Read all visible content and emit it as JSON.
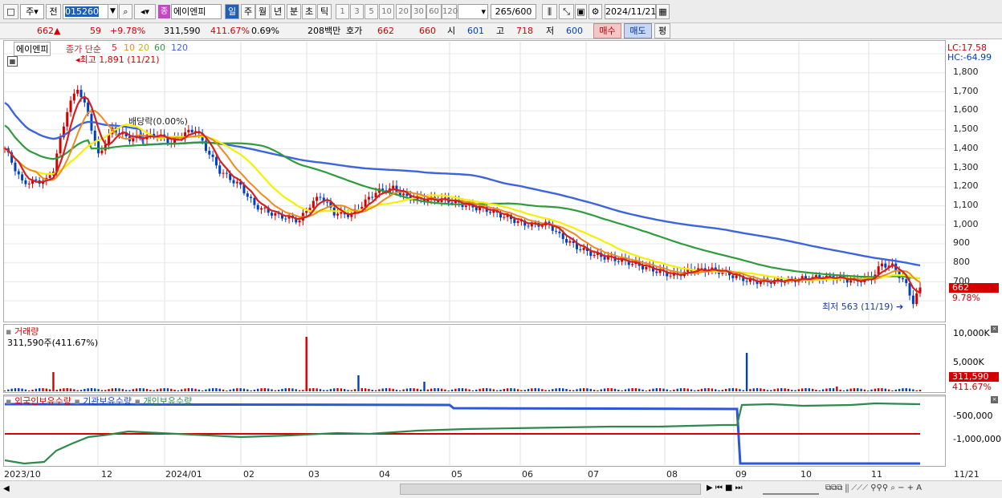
{
  "toolbar": {
    "market": "주",
    "prev_label": "전",
    "code": "015260",
    "stock_name": "에이엔피",
    "badge": "종",
    "period_tabs": [
      "일",
      "주",
      "월",
      "년",
      "분",
      "초",
      "틱"
    ],
    "intervals": [
      "1",
      "3",
      "5",
      "10",
      "20",
      "30",
      "60",
      "120"
    ],
    "count": "265",
    "count_max": "/600",
    "date": "2024/11/21"
  },
  "quote": {
    "price": "662",
    "arrow": "▲",
    "change": "59",
    "change_pct": "+9.78%",
    "volume": "311,590",
    "volume_ratio": "411.67%",
    "turnover": "0.69%",
    "amount": "208백만",
    "hoga_label": "호가",
    "ask": "662",
    "bid": "660",
    "open_label": "시",
    "open": "601",
    "high_label": "고",
    "high": "718",
    "low_label": "저",
    "low": "600",
    "buy_label": "매수",
    "sell_label": "매도",
    "eval_label": "평"
  },
  "price_panel": {
    "stock_name": "에이엔피",
    "ma_title": "종가 단순",
    "ma_periods": [
      "5",
      "10",
      "20",
      "60",
      "120"
    ],
    "high_note": "최고 1,891 (11/21)",
    "dividend_note": "배당락(0.00%)",
    "low_note": "최저 563 (11/19)",
    "lc": "LC:17.58",
    "hc": "HC:-64.99",
    "price_tag": "662",
    "pct_tag": "9.78%",
    "yticks": [
      "1,800",
      "1,700",
      "1,600",
      "1,500",
      "1,400",
      "1,300",
      "1,200",
      "1,100",
      "1,000",
      "900",
      "800",
      "700"
    ]
  },
  "volume_panel": {
    "title": "거래량",
    "value": "311,590주(411.67%)",
    "yticks": [
      "10,000K",
      "5,000K"
    ],
    "tag": "311,590",
    "pct": "411.67%"
  },
  "holding_panel": {
    "foreign": "외국인보유수량",
    "institution": "기관보유수량",
    "individual": "개인보유수량",
    "yticks": [
      "-500,000",
      "-1,000,000"
    ]
  },
  "xaxis": [
    "2023/10",
    "12",
    "2024/01",
    "02",
    "03",
    "04",
    "05",
    "06",
    "07",
    "08",
    "09",
    "10",
    "11"
  ],
  "xaxis_right": "11/21",
  "colors": {
    "up": "#d40000",
    "down": "#0040c0",
    "ma5": "#d62020",
    "ma10": "#f08a1c",
    "ma20": "#f5f000",
    "ma60": "#2e9b3c",
    "ma120": "#3c64dc"
  }
}
